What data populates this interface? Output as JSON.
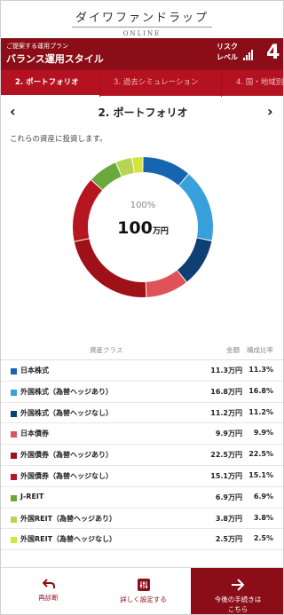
{
  "brand": {
    "name": "ダイワファンドラップ",
    "sub": "ONLINE"
  },
  "plan": {
    "caption": "ご提案する運用プラン",
    "name": "バランス運用スタイル",
    "risk_label_1": "リスク",
    "risk_label_2": "レベル",
    "risk_level": "4"
  },
  "steps": [
    {
      "label": "2. ポートフォリオ"
    },
    {
      "label": "3. 過去シミュレーション"
    },
    {
      "label": "4. 国・地域別"
    }
  ],
  "nav": {
    "title": "2. ポートフォリオ",
    "prev": "‹",
    "next": "›"
  },
  "description": "これらの資産に投資します。",
  "summary": {
    "percent": "100%",
    "total_num": "100",
    "total_unit": "万円"
  },
  "table": {
    "headers": {
      "asset_class": "資産クラス",
      "amount": "金額",
      "ratio": "構成比率"
    },
    "rows": [
      {
        "name": "日本株式",
        "amount": "11.3万円",
        "ratio": "11.3%",
        "color": "#1565b0"
      },
      {
        "name": "外国株式（為替ヘッジあり）",
        "amount": "16.8万円",
        "ratio": "16.8%",
        "color": "#3aa0dc"
      },
      {
        "name": "外国株式（為替ヘッジなし）",
        "amount": "11.2万円",
        "ratio": "11.2%",
        "color": "#0f3f73"
      },
      {
        "name": "日本債券",
        "amount": "9.9万円",
        "ratio": "9.9%",
        "color": "#e0525a"
      },
      {
        "name": "外国債券（為替ヘッジあり）",
        "amount": "22.5万円",
        "ratio": "22.5%",
        "color": "#9e1118"
      },
      {
        "name": "外国債券（為替ヘッジなし）",
        "amount": "15.1万円",
        "ratio": "15.1%",
        "color": "#b5161f"
      },
      {
        "name": "J-REIT",
        "amount": "6.9万円",
        "ratio": "6.9%",
        "color": "#6aa83c"
      },
      {
        "name": "外国REIT（為替ヘッジあり）",
        "amount": "3.8万円",
        "ratio": "3.8%",
        "color": "#b6d653"
      },
      {
        "name": "外国REIT（為替ヘッジなし）",
        "amount": "2.5万円",
        "ratio": "2.5%",
        "color": "#d6e43a"
      }
    ]
  },
  "footer": {
    "back": "再診断",
    "settings": "詳しく設定する",
    "next_1": "今後の手続きは",
    "next_2": "こちら"
  }
}
